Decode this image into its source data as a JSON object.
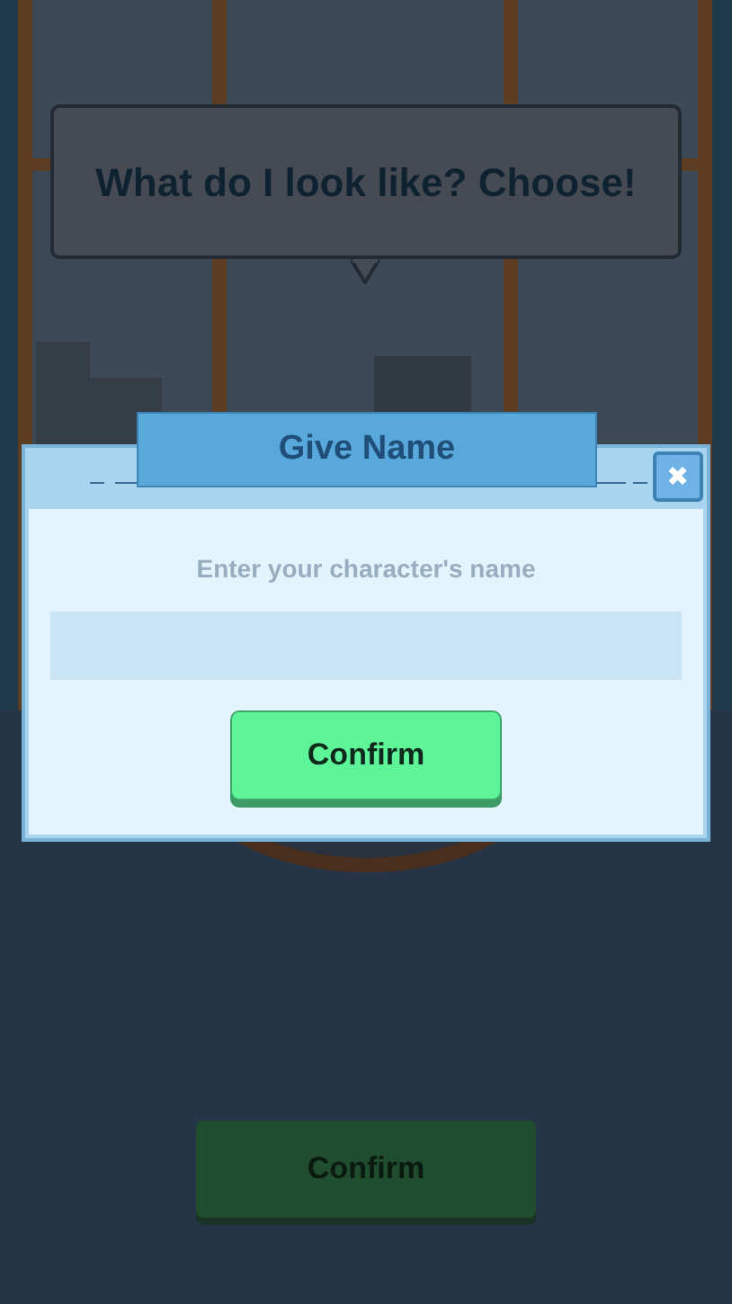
{
  "speech_bubble": {
    "text": "What do I look like? Choose!"
  },
  "confirm_button": {
    "label": "Confirm"
  },
  "dialog": {
    "title": "Give Name",
    "close_button": {
      "label": "✖"
    },
    "prompt": "Enter your character's name",
    "confirm_button": {
      "label": "Confirm"
    }
  }
}
